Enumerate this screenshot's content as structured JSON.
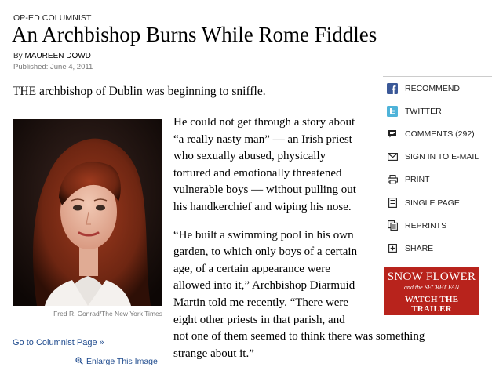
{
  "article": {
    "kicker": "OP-ED COLUMNIST",
    "headline": "An Archbishop Burns While Rome Fiddles",
    "byline_prefix": "By",
    "author": "MAUREEN DOWD",
    "published": "Published: June 4, 2011",
    "lead": "THE archbishop of Dublin was beginning to sniffle.",
    "paragraphs": [
      [
        "He could not get through a story about",
        "“a really nasty man” — an Irish priest",
        "who sexually abused, physically",
        "tortured and emotionally threatened",
        "vulnerable boys — without pulling out",
        "his handkerchief and wiping his nose."
      ],
      [
        "“He built a swimming pool in his own",
        "garden, to which only boys of a certain",
        "age, of a certain appearance were",
        "allowed into it,” Archbishop Diarmuid",
        "Martin told me recently. “There were",
        "eight other priests in that parish, and",
        "not one of them seemed to think there was something",
        "strange about it.”"
      ]
    ]
  },
  "photo": {
    "credit": "Fred R. Conrad/The New York Times",
    "enlarge_label": "Enlarge This Image"
  },
  "columnist_link": "Go to Columnist Page »",
  "tools": [
    {
      "icon": "facebook-icon",
      "label": "RECOMMEND"
    },
    {
      "icon": "twitter-icon",
      "label": "TWITTER"
    },
    {
      "icon": "comment-icon",
      "label": "COMMENTS (292)"
    },
    {
      "icon": "email-icon",
      "label": "SIGN IN TO E-MAIL"
    },
    {
      "icon": "print-icon",
      "label": "PRINT"
    },
    {
      "icon": "single-page-icon",
      "label": "SINGLE PAGE"
    },
    {
      "icon": "reprints-icon",
      "label": "REPRINTS"
    },
    {
      "icon": "share-icon",
      "label": "SHARE"
    }
  ],
  "ad": {
    "line1": "SNOW FLOWER",
    "line2": "and the SECRET FAN",
    "line3": "WATCH THE TRAILER",
    "background": "#b8231c"
  },
  "colors": {
    "link": "#1f4b8e",
    "facebook": "#3b5998",
    "twitter": "#4fb3d9"
  }
}
